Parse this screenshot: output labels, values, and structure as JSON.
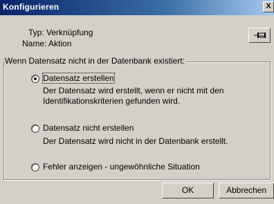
{
  "window": {
    "title": "Konfigurieren",
    "close_glyph": "X"
  },
  "info": {
    "type_label": "Typ: Verknüpfung",
    "name_label": "Name: Aktion",
    "pin_icon": "pin-icon"
  },
  "group": {
    "legend": "Wenn Datensatz nicht in der Datenbank existiert:",
    "options": [
      {
        "label": "Datensatz erstellen",
        "selected": true,
        "focused": true,
        "description_line1": "Der Datensatz wird erstellt, wenn er nicht mit den",
        "description_line2": "Identifikationskriterien gefunden wird."
      },
      {
        "label": "Datensatz nicht erstellen",
        "selected": false,
        "focused": false,
        "description_line1": "Der Datensatz wird nicht in der Datenbank erstellt."
      },
      {
        "label": "Fehler anzeigen - ungewöhnliche Situation",
        "selected": false,
        "focused": false
      }
    ]
  },
  "buttons": {
    "ok": "OK",
    "cancel": "Abbrechen"
  }
}
